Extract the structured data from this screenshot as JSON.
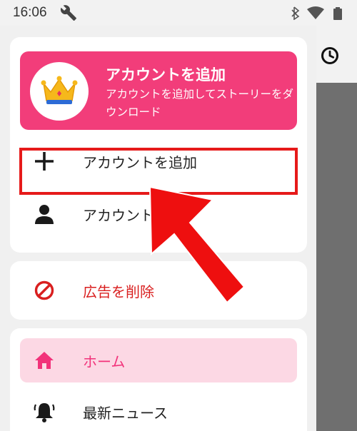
{
  "status_bar": {
    "time": "16:06",
    "icons": [
      "wrench-icon",
      "bluetooth-icon",
      "wifi-icon",
      "battery-icon"
    ]
  },
  "promo": {
    "title": "アカウントを追加",
    "subtitle": "アカウントを追加してストーリーをダウンロード",
    "icon": "crown-icon"
  },
  "menu": {
    "add_account": "アカウントを追加",
    "account": "アカウント",
    "remove_ads": "広告を削除",
    "home": "ホーム",
    "news": "最新ニュース"
  },
  "colors": {
    "accent": "#f23d7a",
    "highlight": "#e61a1a",
    "home_bg": "#fcd8e4",
    "remove_ads": "#d91f1f"
  }
}
